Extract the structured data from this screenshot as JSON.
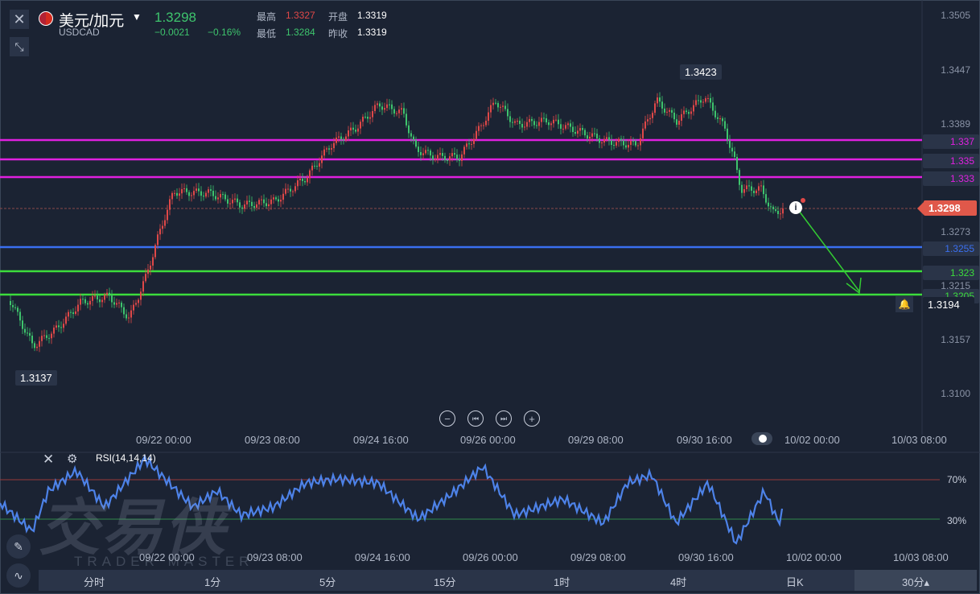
{
  "header": {
    "title": "美元/加元",
    "symbol": "USDCAD",
    "price": "1.3298",
    "change": "−0.0021",
    "change_pct": "−0.16%",
    "high_label": "最高",
    "high_value": "1.3327",
    "low_label": "最低",
    "low_value": "1.3284",
    "open_label": "开盘",
    "open_value": "1.3319",
    "prev_close_label": "昨收",
    "prev_close_value": "1.3319"
  },
  "price_axis": [
    "1.3505",
    "1.3447",
    "1.3389",
    "1.3273",
    "1.3215",
    "1.3157",
    "1.3100"
  ],
  "level_tags": [
    {
      "text": "1.337",
      "color": "#e020e0"
    },
    {
      "text": "1.335",
      "color": "#e020e0"
    },
    {
      "text": "1.333",
      "color": "#e020e0"
    },
    {
      "text": "1.3255",
      "color": "#3a6ff0"
    },
    {
      "text": "1.323",
      "color": "#3cdc3c"
    },
    {
      "text": "1.3205",
      "color": "#3cdc3c"
    }
  ],
  "current_price_tag": "1.3298",
  "alert_price": "1.3194",
  "peak_label": "1.3423",
  "trough_label": "1.3137",
  "time_axis": [
    "09/22 00:00",
    "09/23 08:00",
    "09/24 16:00",
    "09/26 00:00",
    "09/29 08:00",
    "09/30 16:00",
    "10/02 00:00",
    "10/03 08:00"
  ],
  "rsi": {
    "label": "RSI(14,14,14)",
    "upper": "70%",
    "lower": "30%"
  },
  "watermark": {
    "main": "交易侠",
    "sub": "TRADER MASTER"
  },
  "tabs": [
    "分时",
    "1分",
    "5分",
    "15分",
    "1时",
    "4时",
    "日K",
    "30分▴"
  ],
  "colors": {
    "up": "#e04848",
    "down": "#3ec46d",
    "magenta": "#e020e0",
    "blue": "#3a6ff0",
    "green": "#3cdc3c",
    "rsi": "#4d82e8",
    "arrow": "#33cc33"
  },
  "icons": [
    "close-icon",
    "collapse-icon",
    "zoom-out-icon",
    "step-back-icon",
    "step-forward-icon",
    "zoom-in-icon",
    "toggle-icon",
    "bell-icon",
    "gear-icon",
    "pencil-icon",
    "indicator-icon",
    "info-icon",
    "dropdown-icon",
    "flag-icon"
  ]
}
